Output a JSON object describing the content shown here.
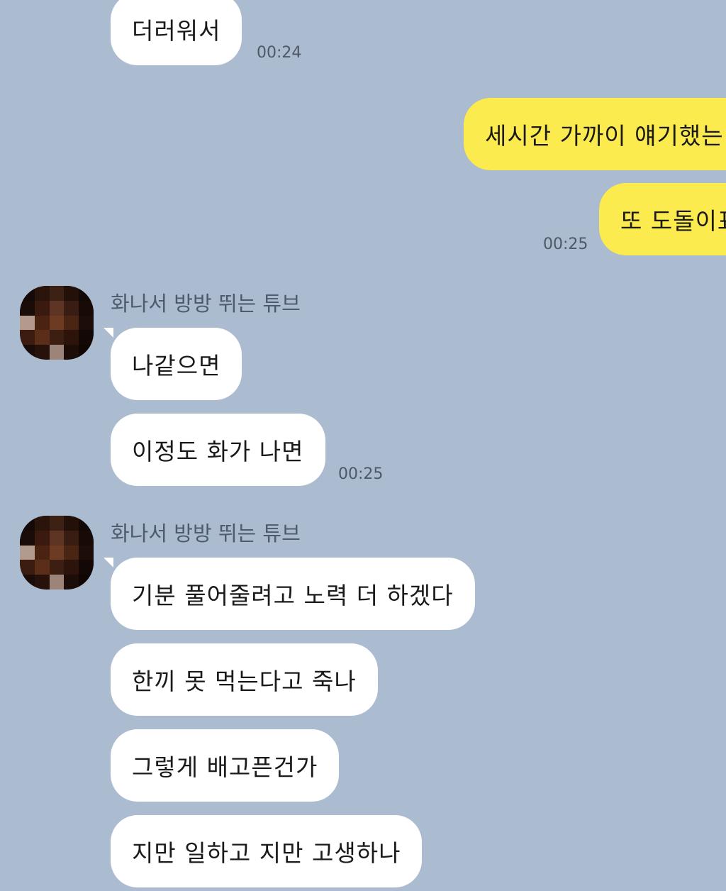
{
  "chat": {
    "messages": {
      "m1": {
        "text": "더러워서",
        "time": "00:24"
      },
      "m2": {
        "text": "세시간 가까이 얘기했는"
      },
      "m3": {
        "text": "또 도돌이표",
        "time": "00:25"
      },
      "group1": {
        "sender": "화나서 방방 뛰는 튜브",
        "m4": {
          "text": "나같으면"
        },
        "m5": {
          "text": "이정도 화가 나면",
          "time": "00:25"
        }
      },
      "group2": {
        "sender": "화나서 방방 뛰는 튜브",
        "m6": {
          "text": "기분 풀어줄려고 노력 더 하겠다"
        },
        "m7": {
          "text": "한끼 못 먹는다고 죽나"
        },
        "m8": {
          "text": "그렇게 배고픈건가"
        },
        "m9": {
          "text": "지만 일하고 지만 고생하나"
        }
      }
    }
  },
  "colors": {
    "background": "#abbbd0",
    "incoming_bubble": "#ffffff",
    "outgoing_bubble": "#fceb4e",
    "timestamp": "#4e5968"
  },
  "icons": {
    "avatar": "pixelated-avatar-icon"
  }
}
